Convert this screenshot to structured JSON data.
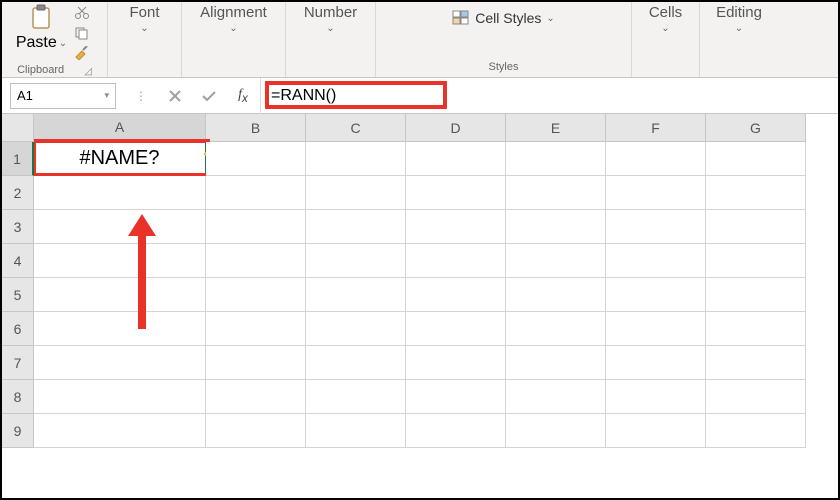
{
  "ribbon": {
    "paste": {
      "label": "Paste"
    },
    "clipboard": {
      "label": "Clipboard"
    },
    "font": {
      "label": "Font"
    },
    "alignment": {
      "label": "Alignment"
    },
    "number": {
      "label": "Number"
    },
    "styles": {
      "label": "Styles",
      "cellStyles": "Cell Styles"
    },
    "cells": {
      "label": "Cells"
    },
    "editing": {
      "label": "Editing"
    }
  },
  "formulaBar": {
    "nameBox": "A1",
    "formula": "=RANN()"
  },
  "columns": [
    "A",
    "B",
    "C",
    "D",
    "E",
    "F",
    "G"
  ],
  "rows": [
    "1",
    "2",
    "3",
    "4",
    "5",
    "6",
    "7",
    "8",
    "9"
  ],
  "cellA1": "#NAME?",
  "colors": {
    "highlight": "#e8322a",
    "selection": "#217346"
  }
}
